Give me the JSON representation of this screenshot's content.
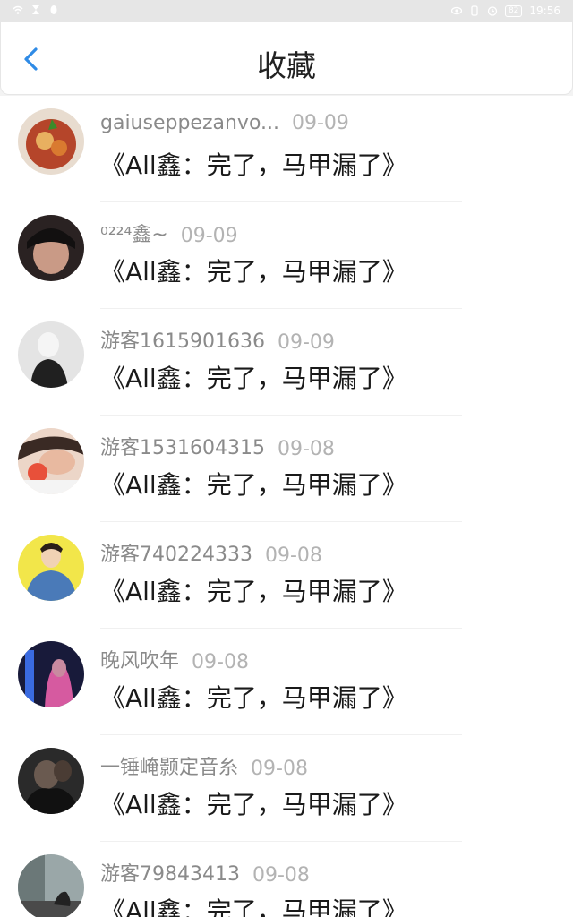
{
  "status_bar": {
    "time": "19:56",
    "battery": "82"
  },
  "header": {
    "title": "收藏"
  },
  "items": [
    {
      "name": "gaiuseppezanvo...",
      "date": "09-09",
      "content": "《All鑫：完了，马甲漏了》",
      "avatar_color": "#c86a3a"
    },
    {
      "name": "⁰²²⁴鑫~",
      "date": "09-09",
      "content": "《All鑫：完了，马甲漏了》",
      "avatar_color": "#3a2a2a"
    },
    {
      "name": "游客1615901636",
      "date": "09-09",
      "content": "《All鑫：完了，马甲漏了》",
      "avatar_color": "#cfcfcf"
    },
    {
      "name": "游客1531604315",
      "date": "09-08",
      "content": "《All鑫：完了，马甲漏了》",
      "avatar_color": "#d9a58a"
    },
    {
      "name": "游客740224333",
      "date": "09-08",
      "content": "《All鑫：完了，马甲漏了》",
      "avatar_color": "#f2e64a"
    },
    {
      "name": "晚风吹年",
      "date": "09-08",
      "content": "《All鑫：完了，马甲漏了》",
      "avatar_color": "#2b2f5a"
    },
    {
      "name": "一锤崦颢定音糸",
      "date": "09-08",
      "content": "《All鑫：完了，马甲漏了》",
      "avatar_color": "#2a2a2a"
    },
    {
      "name": "游客79843413",
      "date": "09-08",
      "content": "《All鑫：完了，马甲漏了》",
      "avatar_color": "#7d8a8a"
    }
  ]
}
